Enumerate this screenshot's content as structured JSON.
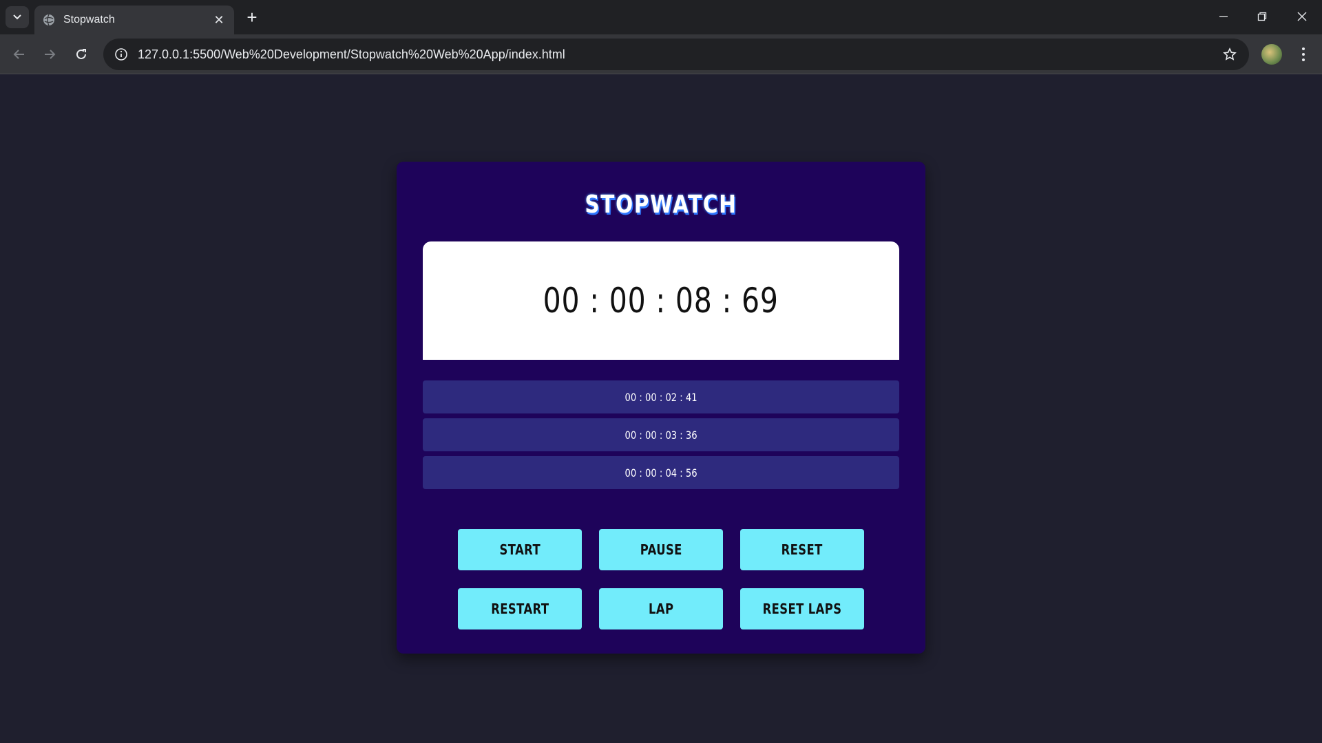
{
  "browser": {
    "tab_title": "Stopwatch",
    "url": "127.0.0.1:5500/Web%20Development/Stopwatch%20Web%20App/index.html"
  },
  "app": {
    "title": "STOPWATCH",
    "time": "00 : 00 : 08 : 69",
    "laps": [
      "00 : 00 : 02 : 41",
      "00 : 00 : 03 : 36",
      "00 : 00 : 04 : 56"
    ],
    "buttons": {
      "start": "START",
      "pause": "PAUSE",
      "reset": "RESET",
      "restart": "RESTART",
      "lap": "LAP",
      "reset_laps": "RESET LAPS"
    }
  },
  "colors": {
    "page_bg": "#1f1f2e",
    "card_bg": "#1e035a",
    "lap_bg": "#2e2a7e",
    "button_bg": "#72ecfb",
    "title_glow": "#2f78ff"
  }
}
